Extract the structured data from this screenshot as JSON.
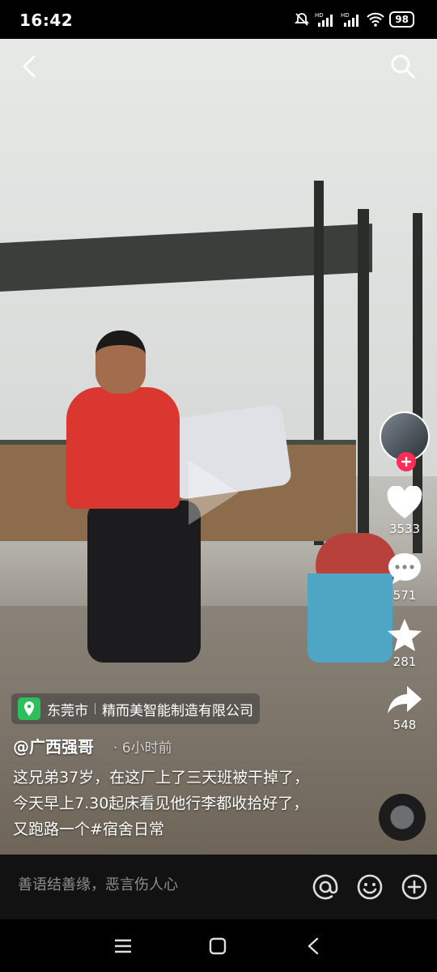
{
  "status_bar": {
    "time": "16:42",
    "battery": "98",
    "icons": [
      "mute-icon",
      "hd-signal-icon",
      "hd-signal-icon",
      "wifi-icon",
      "battery-icon"
    ]
  },
  "top_bar": {
    "back_icon": "back-icon",
    "search_icon": "search-icon"
  },
  "right_rail": {
    "follow_icon": "plus-icon",
    "likes": "3533",
    "comments": "571",
    "favorites": "281",
    "shares": "548"
  },
  "location": {
    "city": "东莞市",
    "place": "精而美智能制造有限公司"
  },
  "post": {
    "author": "@广西强哥",
    "time_ago": "· 6小时前",
    "caption": "这兄弟37岁，在这厂上了三天班被干掉了，今天早上7.30起床看见他行李都收拾好了，又跑路一个#宿舍日常"
  },
  "comment_bar": {
    "placeholder": "善语结善缘，恶言伤人心",
    "icons": [
      "at-icon",
      "emoji-icon",
      "add-icon"
    ]
  },
  "nav_bar": {
    "icons": [
      "menu-icon",
      "home-icon",
      "back-icon"
    ]
  },
  "colors": {
    "accent": "#ff2c55",
    "location_pin": "#2cbf5a"
  }
}
